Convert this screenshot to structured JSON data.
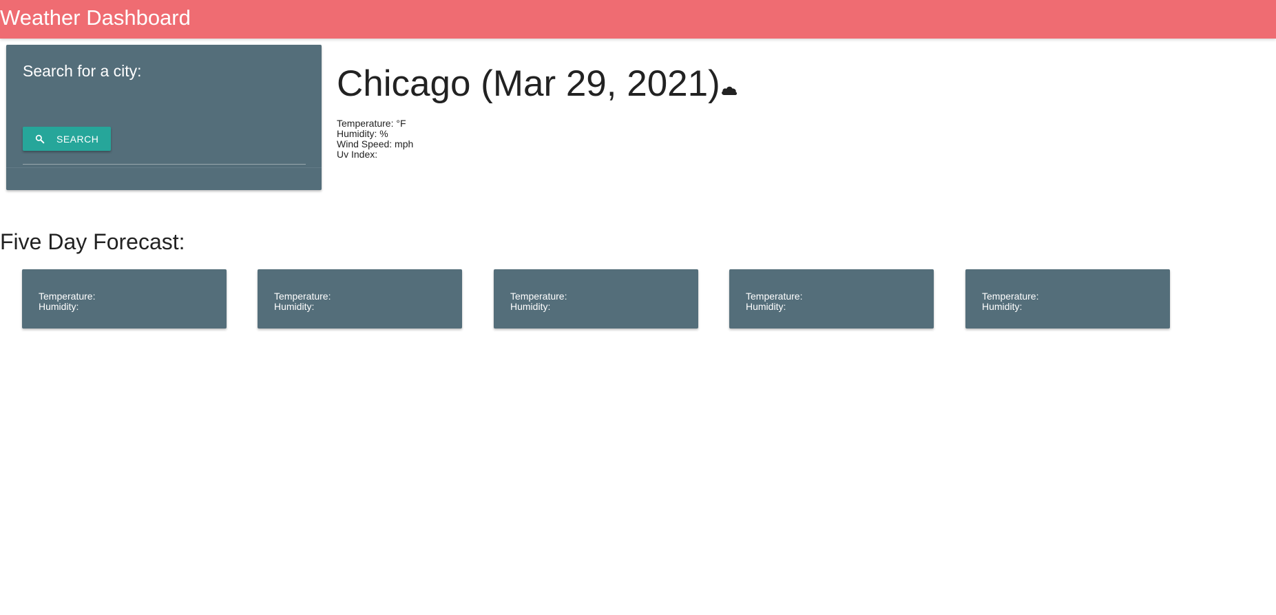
{
  "header": {
    "title": "Weather Dashboard",
    "background_color": "#ef6c72"
  },
  "search": {
    "label": "Search for a city:",
    "input_value": "",
    "input_placeholder": "",
    "button_label": "SEARCH",
    "button_icon": "search-icon",
    "button_color": "#26a69a",
    "card_color": "#546e7a"
  },
  "current": {
    "city_date": "Chicago (Mar 29, 2021)",
    "weather_icon": "cloud-icon",
    "temperature": "Temperature: °F",
    "humidity": "Humidity: %",
    "wind_speed": "Wind Speed: mph",
    "uv_index": "Uv Index:"
  },
  "forecast": {
    "title": "Five Day Forecast:",
    "days": [
      {
        "temperature": "Temperature:",
        "humidity": "Humidity:"
      },
      {
        "temperature": "Temperature:",
        "humidity": "Humidity:"
      },
      {
        "temperature": "Temperature:",
        "humidity": "Humidity:"
      },
      {
        "temperature": "Temperature:",
        "humidity": "Humidity:"
      },
      {
        "temperature": "Temperature:",
        "humidity": "Humidity:"
      }
    ]
  }
}
